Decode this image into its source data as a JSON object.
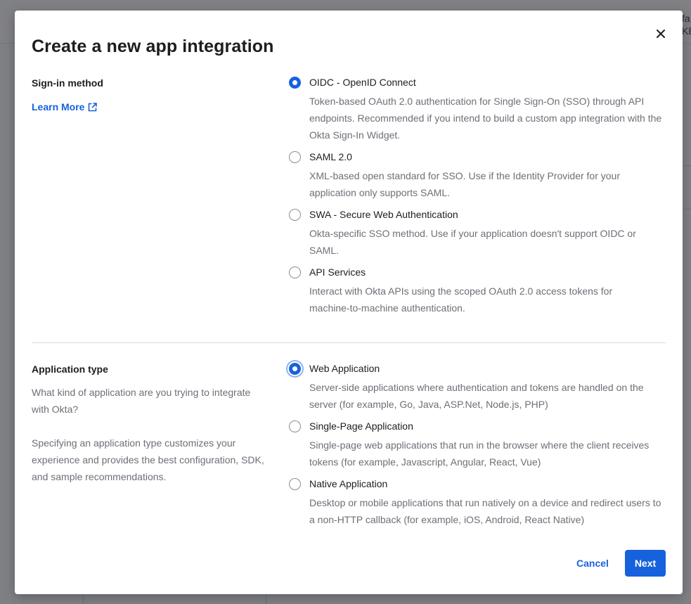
{
  "background": {
    "clipped_text_line1": "fa",
    "clipped_text_line2": "KE"
  },
  "modal": {
    "title": "Create a new app integration",
    "close_icon": "close-icon"
  },
  "sign_in": {
    "label": "Sign-in method",
    "learn_more": "Learn More",
    "learn_more_icon": "external-link-icon",
    "options": [
      {
        "label": "OIDC - OpenID Connect",
        "description": "Token-based OAuth 2.0 authentication for Single Sign-On (SSO) through API endpoints. Recommended if you intend to build a custom app integration with the Okta Sign-In Widget.",
        "selected": true
      },
      {
        "label": "SAML 2.0",
        "description": "XML-based open standard for SSO. Use if the Identity Provider for your application only supports SAML.",
        "selected": false
      },
      {
        "label": "SWA - Secure Web Authentication",
        "description": "Okta-specific SSO method. Use if your application doesn't support OIDC or SAML.",
        "selected": false
      },
      {
        "label": "API Services",
        "description": "Interact with Okta APIs using the scoped OAuth 2.0 access tokens for machine-to-machine authentication.",
        "selected": false
      }
    ]
  },
  "app_type": {
    "label": "Application type",
    "help_1": "What kind of application are you trying to integrate with Okta?",
    "help_2": "Specifying an application type customizes your experience and provides the best configuration, SDK, and sample recommendations.",
    "options": [
      {
        "label": "Web Application",
        "description": "Server-side applications where authentication and tokens are handled on the server (for example, Go, Java, ASP.Net, Node.js, PHP)",
        "selected": true
      },
      {
        "label": "Single-Page Application",
        "description": "Single-page web applications that run in the browser where the client receives tokens (for example, Javascript, Angular, React, Vue)",
        "selected": false
      },
      {
        "label": "Native Application",
        "description": "Desktop or mobile applications that run natively on a device and redirect users to a non-HTTP callback (for example, iOS, Android, React Native)",
        "selected": false
      }
    ]
  },
  "footer": {
    "cancel_label": "Cancel",
    "next_label": "Next"
  },
  "colors": {
    "accent": "#1662dd",
    "overlay": "#7f8084",
    "muted_text": "#6e6e78"
  }
}
